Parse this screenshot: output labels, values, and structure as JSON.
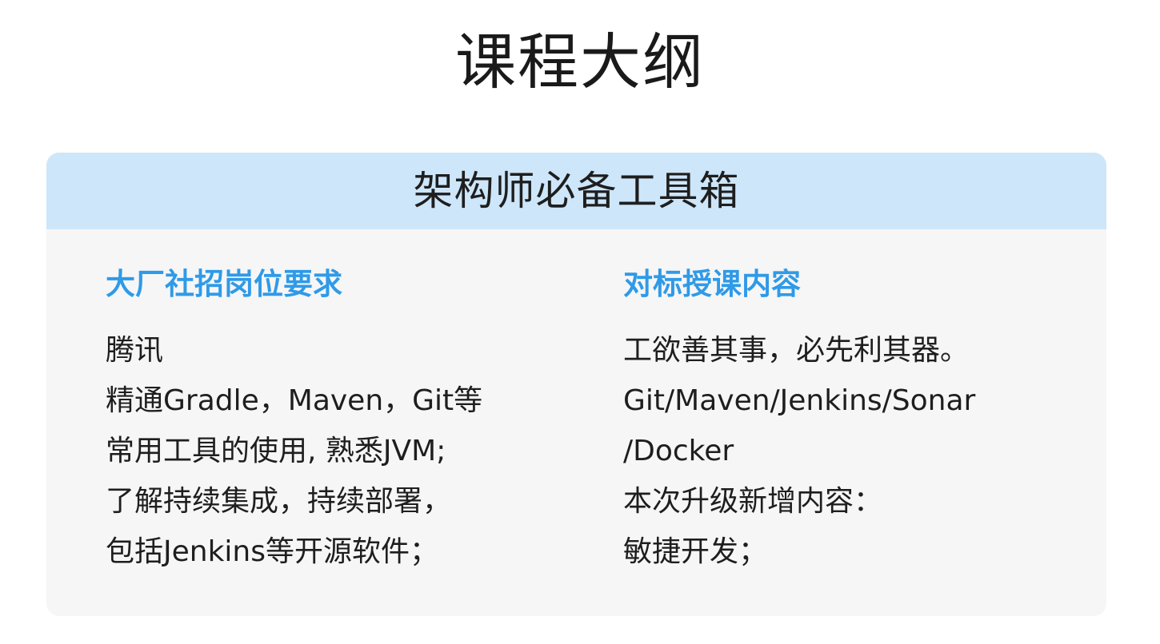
{
  "title": "课程大纲",
  "card": {
    "header": "架构师必备工具箱",
    "left": {
      "heading": "大厂社招岗位要求",
      "lines": [
        "腾讯",
        "精通Gradle，Maven，Git等",
        "常用工具的使用, 熟悉JVM;",
        "了解持续集成，持续部署，",
        "包括Jenkins等开源软件；"
      ]
    },
    "right": {
      "heading": "对标授课内容",
      "lines": [
        "工欲善其事，必先利其器。",
        "Git/Maven/Jenkins/Sonar",
        "/Docker",
        "本次升级新增内容：",
        "敏捷开发；"
      ]
    }
  },
  "colors": {
    "header_bg": "#cde6fa",
    "card_bg": "#f6f6f6",
    "heading_accent": "#2f9ae8",
    "text": "#1e1e1e"
  }
}
